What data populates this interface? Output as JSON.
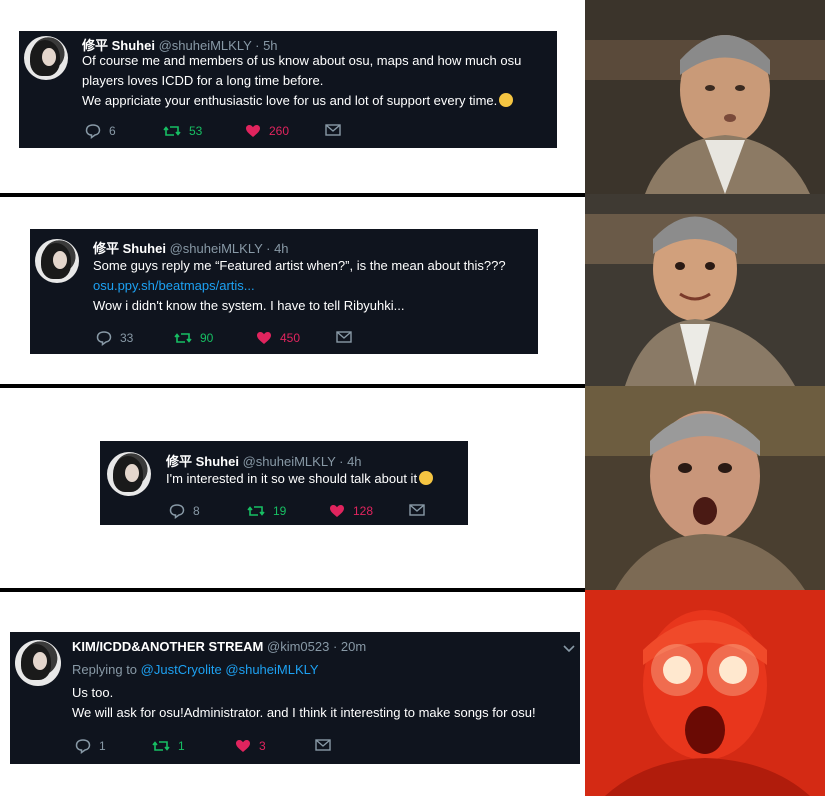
{
  "tweets": [
    {
      "name": "修平 Shuhei",
      "handle": "@shuheiMLKLY · 5h",
      "lines": [
        "Of course me and members of us know about osu, maps and how much osu",
        "players loves ICDD for a long time before.",
        "We appriciate your enthusiastic love for us and lot of support every time."
      ],
      "replies": "6",
      "retweets": "53",
      "likes": "260"
    },
    {
      "name": "修平 Shuhei",
      "handle": "@shuheiMLKLY · 4h",
      "line1": "Some guys reply me “Featured artist when?”, is the mean about this???",
      "link": "osu.ppy.sh/beatmaps/artis...",
      "line3": "Wow i didn't know the system. I have to tell Ribyuhki...",
      "replies": "33",
      "retweets": "90",
      "likes": "450"
    },
    {
      "name": "修平 Shuhei",
      "handle": "@shuheiMLKLY · 4h",
      "line1": "I'm interested in it so we should talk about it",
      "replies": "8",
      "retweets": "19",
      "likes": "128"
    },
    {
      "name": "KIM/ICDD&ANOTHER STREAM",
      "handle": "@kim0523 · 20m",
      "replying_prefix": "Replying to",
      "replying_to": "@JustCryolite @shuheiMLKLY",
      "line1": "Us too.",
      "line2": "We will ask for osu!Administrator. and I think it interesting to make songs for osu!",
      "replies": "1",
      "retweets": "1",
      "likes": "3"
    }
  ],
  "meme_levels": [
    "level-1",
    "level-2",
    "level-3",
    "level-4"
  ],
  "colors": {
    "tweet_bg": "#0f141e",
    "retweet": "#17bf63",
    "like": "#e0245e",
    "link": "#1da1f2"
  }
}
